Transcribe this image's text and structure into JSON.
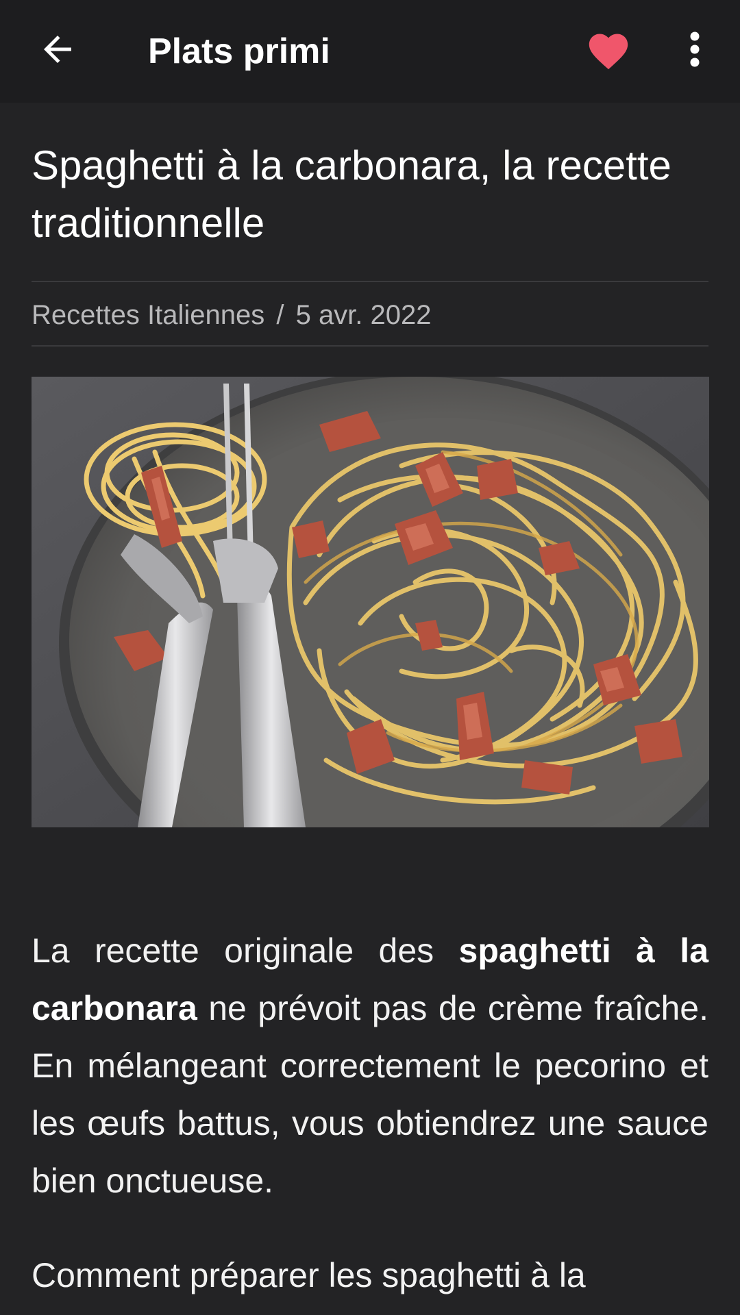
{
  "app_bar": {
    "title": "Plats primi",
    "icons": {
      "back": "arrow-left-icon",
      "favorite": "heart-icon",
      "more": "more-vertical-icon"
    },
    "favorite_color": "#f0566b"
  },
  "article": {
    "title": "Spaghetti à la carbonara, la recette traditionnelle",
    "category": "Recettes Italiennes",
    "separator": "/",
    "date": "5 avr. 2022",
    "image_subject": "spaghetti carbonara plate with fork and spoon",
    "paragraph1": {
      "part1": "La recette originale des ",
      "bold": "spaghetti à la carbonara",
      "part2": " ne prévoit pas de crème fraîche. En mélangeant correctement le pecorino et les œufs battus, vous obtiendrez une sauce bien onctueuse."
    },
    "paragraph2": "Comment préparer les spaghetti à la"
  },
  "colors": {
    "background": "#232325",
    "app_bar": "#1d1d1f",
    "meta_text": "#b9b9bb",
    "divider": "#3a3a3d"
  }
}
